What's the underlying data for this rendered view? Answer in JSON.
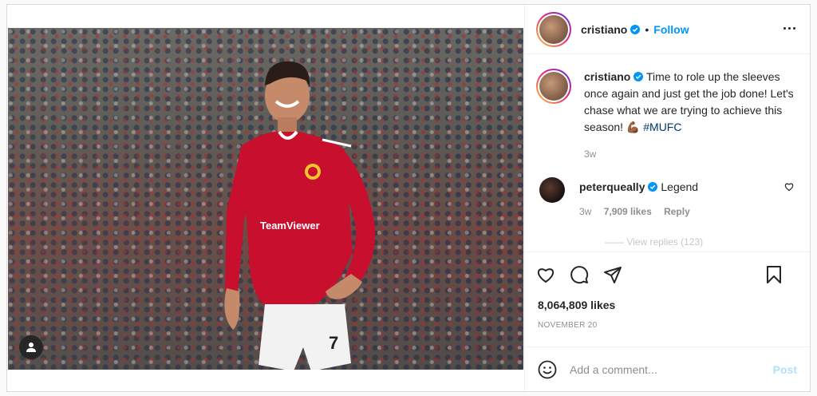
{
  "post": {
    "author": {
      "username": "cristiano",
      "verified": true,
      "follow_label": "Follow",
      "separator": "•"
    },
    "media": {
      "kind": "photo",
      "has_user_tags": true,
      "jersey_sponsor": "TeamViewer",
      "shirt_number": "7"
    },
    "caption": {
      "username": "cristiano",
      "text": "Time to role up the sleeves once again and just get the job done! Let's chase what we are trying to achieve this season! 💪🏾 ",
      "hashtag": "#MUFC",
      "time": "3w"
    },
    "comments": [
      {
        "username": "peterqueally",
        "verified": true,
        "text": "Legend",
        "time": "3w",
        "likes": "7,909 likes",
        "reply_label": "Reply"
      }
    ],
    "view_replies": "—— View replies (123)",
    "likes": "8,064,809 likes",
    "date": "November 20",
    "add_comment": {
      "placeholder": "Add a comment...",
      "post_label": "Post"
    }
  },
  "colors": {
    "accent": "#0095f6",
    "post_disabled": "#b2dffc",
    "secondary_text": "#8e8e8e",
    "hashtag": "#00376b",
    "jersey": "#c8102e"
  }
}
